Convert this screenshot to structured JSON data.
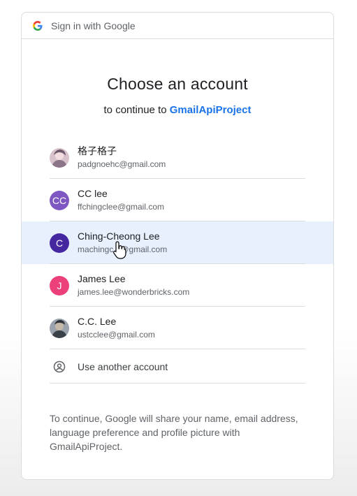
{
  "header": {
    "text": "Sign in with Google",
    "logo_icon": "google-g-icon"
  },
  "title": "Choose an account",
  "subtitle": {
    "prefix": "to continue to",
    "project": "GmailApiProject"
  },
  "accounts": [
    {
      "name": "格子格子",
      "email": "padgnoehc@gmail.com",
      "avatar": "photo",
      "avatar_colors": [
        "#c9a5b5",
        "#7b6b7a"
      ]
    },
    {
      "name": "CC lee",
      "email": "ffchingclee@gmail.com",
      "avatar": "initials",
      "initials": "CC",
      "color": "#7e57c2"
    },
    {
      "name": "Ching-Cheong Lee",
      "email": "machingc...@gmail.com",
      "avatar": "initials",
      "initials": "C",
      "color": "#4527a0",
      "state": "hovered"
    },
    {
      "name": "James Lee",
      "email": "james.lee@wonderbricks.com",
      "avatar": "initials",
      "initials": "J",
      "color": "#ec407a"
    },
    {
      "name": "C.C. Lee",
      "email": "ustcclee@gmail.com",
      "avatar": "photo",
      "avatar_colors": [
        "#6d7680",
        "#3a4048"
      ]
    }
  ],
  "use_another": {
    "label": "Use another account",
    "icon": "account-circle-icon"
  },
  "disclaimer": "To continue, Google will share your name, email address, language preference and profile picture with GmailApiProject.",
  "colors": {
    "accent": "#1a73e8",
    "hover_bg": "#e8f0fe",
    "divider": "#dadce0"
  }
}
